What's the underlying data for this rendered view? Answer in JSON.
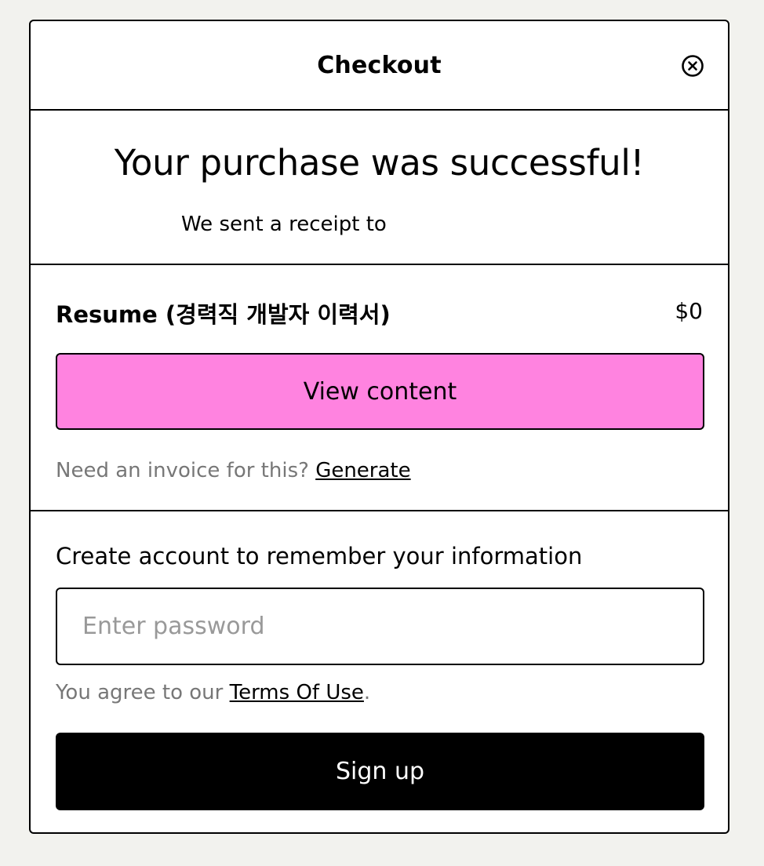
{
  "header": {
    "title": "Checkout",
    "close_icon": "close-circle-icon"
  },
  "success": {
    "title": "Your purchase was successful!",
    "subtitle": "We sent a receipt to"
  },
  "product": {
    "name": "Resume (경력직 개발자 이력서)",
    "price": "$0",
    "view_button_label": "View content",
    "view_button_color": "#ff83e0",
    "invoice_prompt": "Need an invoice for this?",
    "invoice_link": "Generate"
  },
  "account": {
    "title": "Create account to remember your information",
    "password_placeholder": "Enter password",
    "password_value": "",
    "terms_prefix": "You agree to our",
    "terms_link": "Terms Of Use",
    "terms_suffix": ".",
    "signup_label": "Sign up"
  }
}
